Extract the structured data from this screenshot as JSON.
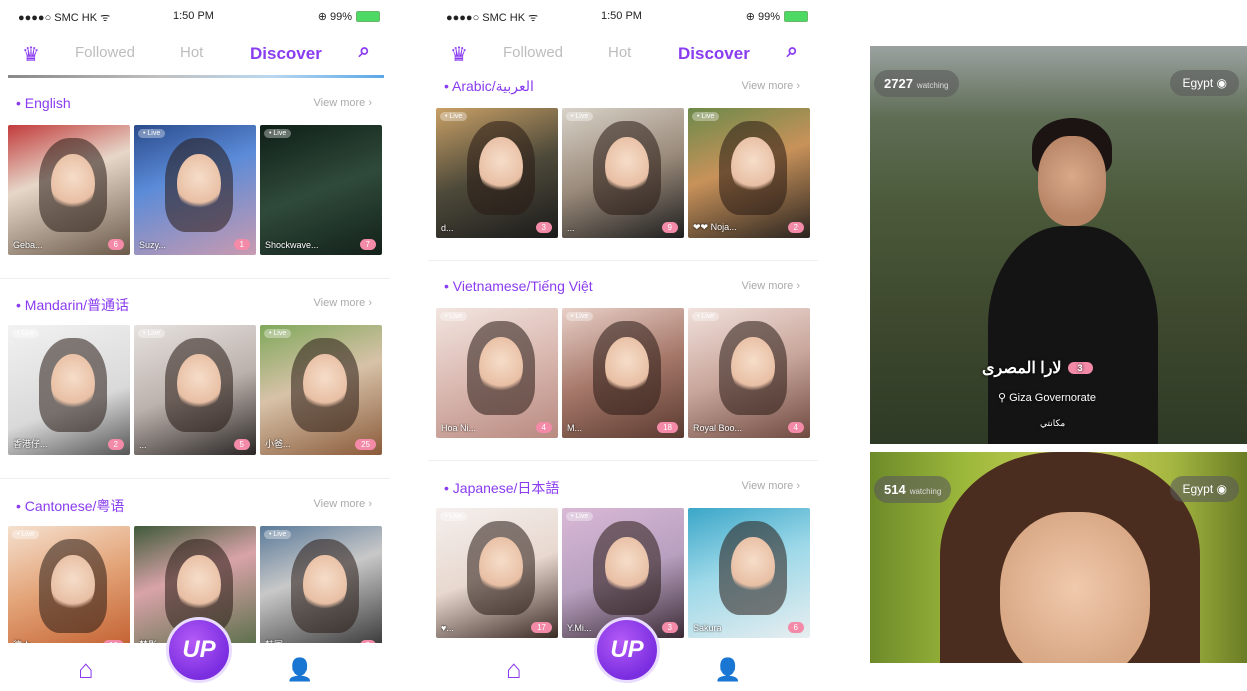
{
  "status": {
    "carrier": "●●●●○ SMC HK ᯤ",
    "time": "1:50 PM",
    "battery": "⊕ 99%"
  },
  "nav": {
    "followed": "Followed",
    "hot": "Hot",
    "discover": "Discover"
  },
  "colors": {
    "accent": "#8a3cf0",
    "badge": "#f28aa8"
  },
  "icons": {
    "crown": "crown-icon",
    "search": "search-icon",
    "home": "home-icon",
    "profile": "profile-icon",
    "up": "up-logo"
  },
  "phone1": {
    "sections": [
      {
        "title": "• English",
        "view_more": "View more ›",
        "items": [
          {
            "name": "Geba...",
            "viewers": "6"
          },
          {
            "name": "Suzy...",
            "viewers": "1"
          },
          {
            "name": "Shockwave...",
            "viewers": "7"
          }
        ]
      },
      {
        "title": "• Mandarin/普通话",
        "view_more": "View more ›",
        "items": [
          {
            "name": "香港仔...",
            "viewers": "2"
          },
          {
            "name": "...",
            "viewers": "5"
          },
          {
            "name": "小爸...",
            "viewers": "25"
          }
        ]
      },
      {
        "title": "• Cantonese/粤语",
        "view_more": "View more ›",
        "items": [
          {
            "name": "德★...",
            "viewers": "10"
          },
          {
            "name": "梦影...",
            "viewers": ""
          },
          {
            "name": "韩国...",
            "viewers": "3"
          }
        ]
      }
    ]
  },
  "phone2": {
    "sections": [
      {
        "title": "• Arabic/العربية",
        "view_more": "View more ›",
        "items": [
          {
            "name": "d...",
            "viewers": "3"
          },
          {
            "name": "...",
            "viewers": "9"
          },
          {
            "name": "❤❤ Noja...",
            "viewers": "2"
          }
        ]
      },
      {
        "title": "• Vietnamese/Tiếng Việt",
        "view_more": "View more ›",
        "items": [
          {
            "name": "Hoa Ni...",
            "viewers": "4"
          },
          {
            "name": "M...",
            "viewers": "18"
          },
          {
            "name": "Royal Boo...",
            "viewers": "4"
          }
        ]
      },
      {
        "title": "• Japanese/日本語",
        "view_more": "View more ›",
        "items": [
          {
            "name": "♥...",
            "viewers": "17"
          },
          {
            "name": "Y.Mi...",
            "viewers": "3"
          },
          {
            "name": "Sakura",
            "viewers": "6"
          }
        ]
      }
    ]
  },
  "live_label": "• Live",
  "up_label": "UP",
  "card1": {
    "watching": "2727",
    "watching_label": "watching",
    "country": "Egypt",
    "name": "لارا المصرى",
    "badge": "3",
    "location": "Giza Governorate",
    "sub": "مكانتي"
  },
  "card2": {
    "watching": "514",
    "watching_label": "watching",
    "country": "Egypt"
  }
}
